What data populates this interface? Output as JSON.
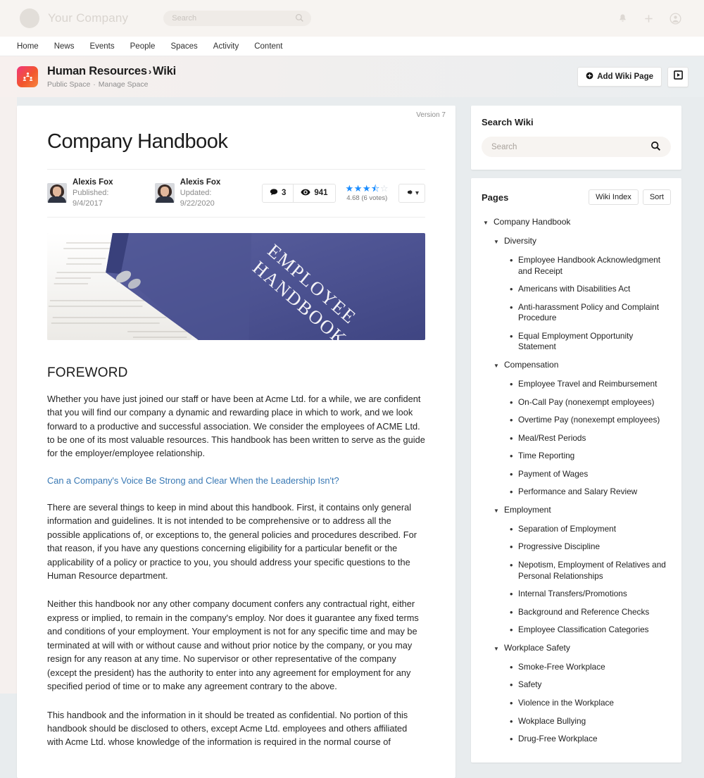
{
  "topbar": {
    "brand_name": "Your Company",
    "search_placeholder": "Search",
    "icons": {
      "notifications": "bell-icon",
      "create": "plus-icon",
      "account": "account-circle-icon"
    }
  },
  "nav": {
    "items": [
      "Home",
      "News",
      "Events",
      "People",
      "Spaces",
      "Activity",
      "Content"
    ]
  },
  "space": {
    "title": "Human Resources",
    "separator": "›",
    "subtitle_current": "Wiki",
    "visibility": "Public Space",
    "manage": "Manage Space",
    "add_button": "Add Wiki Page",
    "video_button_icon": "play-box-icon",
    "icon_gradient_from": "#f0367c",
    "icon_gradient_to": "#f6853f"
  },
  "article": {
    "version": "Version 7",
    "title": "Company Handbook",
    "authors": [
      {
        "name": "Alexis Fox",
        "date": "Published: 9/4/2017"
      },
      {
        "name": "Alexis Fox",
        "date": "Updated: 9/22/2020"
      }
    ],
    "comments_count": "3",
    "views_count": "941",
    "rating_value": 3.5,
    "rating_text": "4.68 (6 votes)",
    "star_color": "#1a8cff",
    "hero": {
      "alt": "blue employee handbook binder on paperwork",
      "line1": "EMPLOYEE",
      "line2": "HANDBOOK",
      "binder_color": "#4f5593"
    },
    "heading_foreword": "FOREWORD",
    "paragraphs": [
      "Whether you have just joined our staff or have been at Acme Ltd. for a while, we are confident that you will find our company a dynamic and rewarding place in which to work, and we look forward to a productive and successful association. We consider the employees of ACME Ltd. to be one of its most valuable resources. This handbook has been written to serve as the guide for the employer/employee relationship."
    ],
    "link_text": "Can a Company's Voice Be Strong and Clear When the Leadership Isn't?",
    "paragraphs_after": [
      "There are several things to keep in mind about this handbook. First, it contains only general information and guidelines. It is not intended to be comprehensive or to address all the possible applications of, or exceptions to, the general policies and procedures described. For that reason, if you have any questions concerning eligibility for a particular benefit or the applicability of a policy or practice to you, you should address your specific questions to the Human Resource department.",
      "Neither this handbook nor any other company document confers any contractual right, either express or implied, to remain in the company's employ. Nor does it guarantee any fixed terms and conditions of your employment. Your employment is not for any specific time and may be terminated at will with or without cause and without prior notice by the company, or you may resign for any reason at any time. No supervisor or other representative of the company (except the president) has the authority to enter into any agreement for employment for any specified period of time or to make any agreement contrary to the above.",
      "This handbook and the information in it should be treated as confidential. No portion of this handbook should be disclosed to others, except Acme Ltd. employees and others affiliated with Acme Ltd. whose knowledge of the information is required in the normal course of"
    ]
  },
  "search_wiki": {
    "title": "Search Wiki",
    "placeholder": "Search",
    "icon": "search-icon"
  },
  "pages_panel": {
    "title": "Pages",
    "wiki_index_label": "Wiki Index",
    "sort_label": "Sort",
    "tree": [
      {
        "level": 0,
        "type": "caret",
        "label": "Company Handbook"
      },
      {
        "level": 1,
        "type": "caret",
        "label": "Diversity"
      },
      {
        "level": 2,
        "type": "bullet",
        "label": "Employee Handbook Acknowledgment and Receipt"
      },
      {
        "level": 2,
        "type": "bullet",
        "label": "Americans with Disabilities Act"
      },
      {
        "level": 2,
        "type": "bullet",
        "label": "Anti-harassment Policy and Complaint Procedure"
      },
      {
        "level": 2,
        "type": "bullet",
        "label": "Equal Employment Opportunity Statement"
      },
      {
        "level": 1,
        "type": "caret",
        "label": "Compensation"
      },
      {
        "level": 2,
        "type": "bullet",
        "label": "Employee Travel and Reimbursement"
      },
      {
        "level": 2,
        "type": "bullet",
        "label": "On-Call Pay (nonexempt employees)"
      },
      {
        "level": 2,
        "type": "bullet",
        "label": "Overtime Pay (nonexempt employees)"
      },
      {
        "level": 2,
        "type": "bullet",
        "label": "Meal/Rest Periods"
      },
      {
        "level": 2,
        "type": "bullet",
        "label": "Time Reporting"
      },
      {
        "level": 2,
        "type": "bullet",
        "label": "Payment of Wages"
      },
      {
        "level": 2,
        "type": "bullet",
        "label": "Performance and Salary Review"
      },
      {
        "level": 1,
        "type": "caret",
        "label": "Employment"
      },
      {
        "level": 2,
        "type": "bullet",
        "label": "Separation of Employment"
      },
      {
        "level": 2,
        "type": "bullet",
        "label": "Progressive Discipline"
      },
      {
        "level": 2,
        "type": "bullet",
        "label": "Nepotism, Employment of Relatives and Personal Relationships"
      },
      {
        "level": 2,
        "type": "bullet",
        "label": "Internal Transfers/Promotions"
      },
      {
        "level": 2,
        "type": "bullet",
        "label": "Background and Reference Checks"
      },
      {
        "level": 2,
        "type": "bullet",
        "label": "Employee Classification Categories"
      },
      {
        "level": 1,
        "type": "caret",
        "label": "Workplace Safety"
      },
      {
        "level": 2,
        "type": "bullet",
        "label": "Smoke-Free Workplace"
      },
      {
        "level": 2,
        "type": "bullet",
        "label": "Safety"
      },
      {
        "level": 2,
        "type": "bullet",
        "label": "Violence in the Workplace"
      },
      {
        "level": 2,
        "type": "bullet",
        "label": "Wokplace Bullying"
      },
      {
        "level": 2,
        "type": "bullet",
        "label": "Drug-Free Workplace"
      }
    ]
  }
}
